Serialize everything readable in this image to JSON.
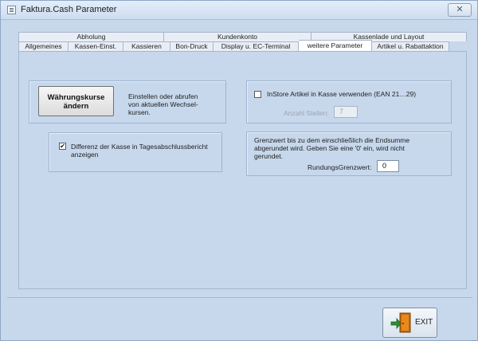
{
  "window": {
    "title": "Faktura.Cash Parameter",
    "close_glyph": "✕"
  },
  "tabs": {
    "top_row": [
      "Abholung",
      "Kundenkonto",
      "Kassenlade und Layout"
    ],
    "bottom_row": [
      "Allgemeines",
      "Kassen-Einst.",
      "Kassieren",
      "Bon-Druck",
      "Display u. EC-Terminal",
      "weitere Parameter",
      "Artikel u. Rabattaktion"
    ],
    "active": "weitere Parameter"
  },
  "currency": {
    "button_label_line1": "Währungskurse",
    "button_label_line2": "ändern",
    "description_line1": "Einstellen oder abrufen",
    "description_line2": "von aktuellen Wechsel-",
    "description_line3": "kursen."
  },
  "instore": {
    "checkbox_label": "InStore Artikel in Kasse verwenden (EAN 21…29)",
    "checked": false,
    "digits_label": "Anzahl Stellen:",
    "digits_value": "7"
  },
  "difference": {
    "checkbox_label_line1": "Differenz der Kasse in Tagesabschlussbericht",
    "checkbox_label_line2": "anzeigen",
    "checked": true,
    "check_glyph": "✔"
  },
  "rounding": {
    "description_line1": "Grenzwert bis zu dem einschließlich die Endsumme",
    "description_line2": "abgerundet wird. Geben Sie eine '0' ein, wird nicht",
    "description_line3": "gerundet.",
    "limit_label": "RundungsGrenzwert:",
    "limit_value": "0"
  },
  "footer": {
    "exit_label": "EXIT",
    "exit_icon": "exit-door-icon"
  },
  "colors": {
    "window_bg": "#c7d8ed",
    "accent_orange": "#e88a1a",
    "exit_arrow": "#2f8f2f"
  }
}
